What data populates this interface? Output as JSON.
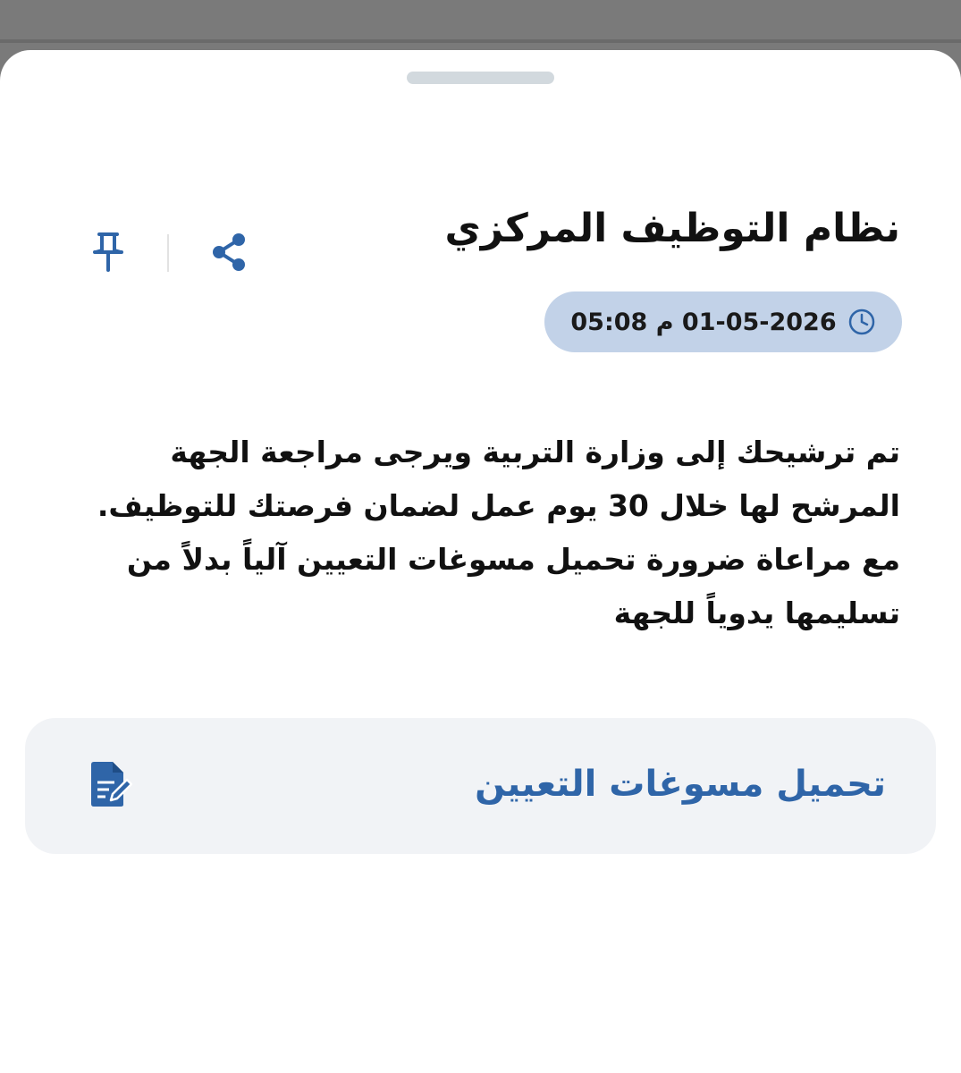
{
  "notification": {
    "title": "نظام التوظيف المركزي",
    "timestamp": "01-05-2026 م 05:08",
    "body": "تم ترشيحك إلى وزارة التربية ويرجى مراجعة الجهة المرشح لها خلال 30 يوم عمل لضمان فرصتك للتوظيف. مع مراعاة ضرورة تحميل مسوغات التعيين آلياً بدلاً من تسليمها يدوياً للجهة"
  },
  "actions": {
    "share_icon": "share-icon",
    "pin_icon": "pin-icon",
    "upload_label": "تحميل مسوغات التعيين",
    "upload_icon": "document-edit-icon"
  },
  "colors": {
    "accent": "#2f65a8",
    "pill_bg": "#c2d2e8",
    "card_bg": "#f1f3f6"
  }
}
